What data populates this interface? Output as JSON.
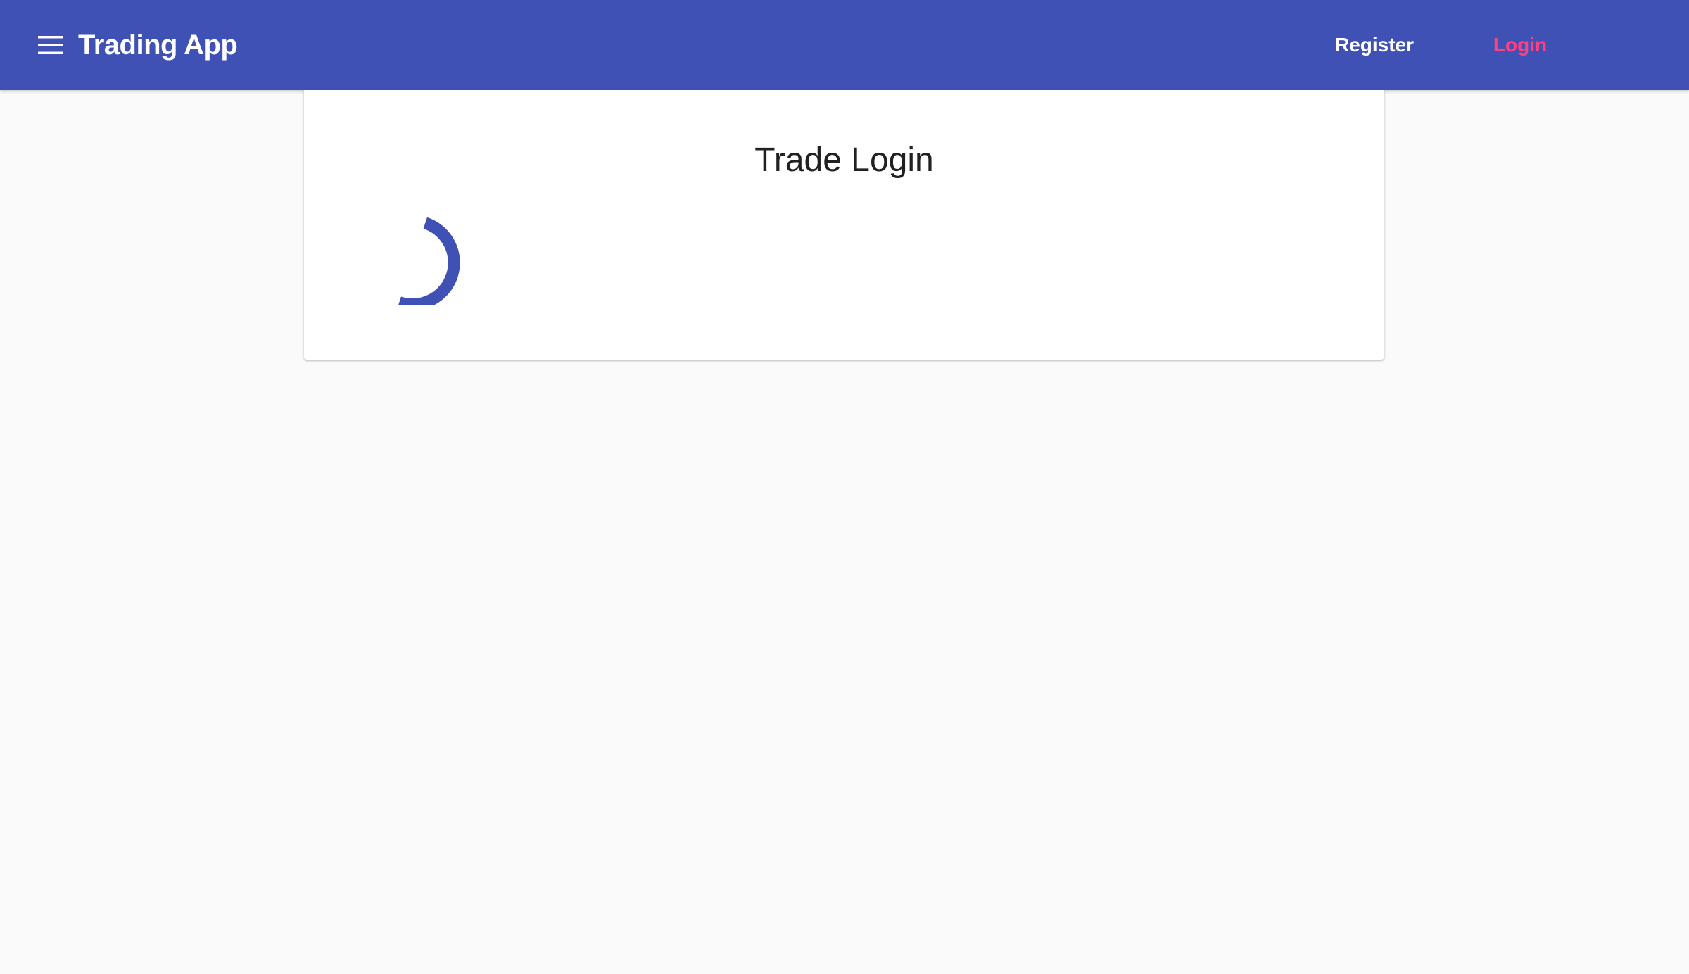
{
  "toolbar": {
    "menu_icon": "menu-icon",
    "app_title": "Trading App",
    "register_label": "Register",
    "login_label": "Login",
    "background_color": "#3f51b5",
    "active_link_color": "#ff4081"
  },
  "card": {
    "title": "Trade Login",
    "spinner_icon": "loading-spinner-icon",
    "spinner_color": "#3f51b5"
  }
}
